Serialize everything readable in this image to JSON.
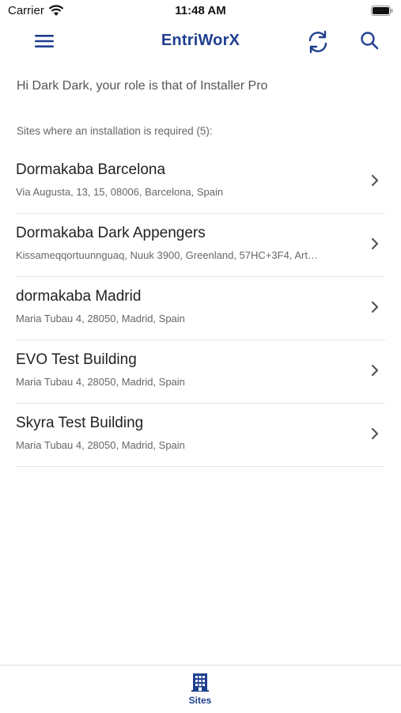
{
  "status_bar": {
    "carrier": "Carrier",
    "time": "11:48 AM"
  },
  "header": {
    "title": "EntriWorX"
  },
  "greeting": "Hi Dark Dark, your role is that of Installer Pro",
  "section_header": "Sites where an installation is required (5):",
  "sites": [
    {
      "name": "Dormakaba Barcelona",
      "address": "Via Augusta, 13, 15, 08006, Barcelona, Spain"
    },
    {
      "name": "Dormakaba Dark Appengers",
      "address": "Kissameqqortuunnguaq, Nuuk 3900, Greenland, 57HC+3F4, Art…"
    },
    {
      "name": "dormakaba Madrid",
      "address": "Maria Tubau 4, 28050, Madrid, Spain"
    },
    {
      "name": "EVO Test Building",
      "address": "Maria Tubau 4, 28050, Madrid, Spain"
    },
    {
      "name": "Skyra Test Building",
      "address": "Maria Tubau 4, 28050, Madrid, Spain"
    }
  ],
  "tab_bar": {
    "sites_label": "Sites"
  },
  "colors": {
    "accent": "#1f3f8f"
  },
  "icons": [
    "wifi-icon",
    "battery-icon",
    "hamburger-menu-icon",
    "sync-icon",
    "search-icon",
    "chevron-right-icon",
    "building-icon"
  ]
}
